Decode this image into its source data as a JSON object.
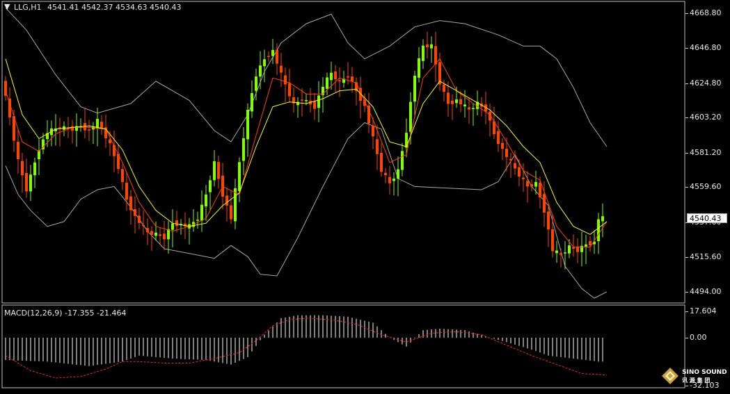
{
  "header": {
    "symbol": "LLG,H1",
    "ohlc": "4541.41 4542.37 4534.63 4540.43",
    "menu_icon": "triangle-down-icon"
  },
  "price_axis": {
    "ticks": [
      "4668.80",
      "4646.80",
      "4624.80",
      "4603.20",
      "4581.20",
      "4559.60",
      "4537.60",
      "4515.60",
      "4494.00"
    ],
    "tick_values": [
      4668.8,
      4646.8,
      4624.8,
      4603.2,
      4581.2,
      4559.6,
      4537.6,
      4515.6,
      4494.0
    ],
    "current_price": "4540.43"
  },
  "macd_panel": {
    "label": "MACD(12,26,9) -17.355 -21.464",
    "axis_ticks": [
      "17.604",
      "0.00",
      "-32.103"
    ],
    "tick_values": [
      17.604,
      0.0,
      -32.103
    ]
  },
  "logo": {
    "line1": "SINO SOUND",
    "line2": "讯 源 集 团"
  },
  "colors": {
    "background": "#000000",
    "bull": "#7fff00",
    "bear": "#ff4500",
    "bands": "#a9a9a9",
    "ma_fast": "#ff4500",
    "ma_slow": "#ffff00",
    "macd_hist": "#ffffff",
    "macd_signal": "#ff2020",
    "frame": "#c0c0c0"
  },
  "chart_data": {
    "type": "candlestick",
    "title": "LLG,H1",
    "ylim": [
      4487,
      4676
    ],
    "bar_spacing": 6,
    "anchors": [
      [
        0,
        4628
      ],
      [
        2,
        4603
      ],
      [
        4,
        4576
      ],
      [
        6,
        4558
      ],
      [
        9,
        4584
      ],
      [
        11,
        4594
      ],
      [
        14,
        4597
      ],
      [
        17,
        4596
      ],
      [
        19,
        4598
      ],
      [
        21,
        4595
      ],
      [
        23,
        4601
      ],
      [
        26,
        4586
      ],
      [
        28,
        4572
      ],
      [
        30,
        4552
      ],
      [
        32,
        4541
      ],
      [
        35,
        4531
      ],
      [
        37,
        4530
      ],
      [
        39,
        4528
      ],
      [
        41,
        4537
      ],
      [
        45,
        4535
      ],
      [
        47,
        4540
      ],
      [
        49,
        4555
      ],
      [
        51,
        4575
      ],
      [
        53,
        4555
      ],
      [
        55,
        4540
      ],
      [
        57,
        4575
      ],
      [
        59,
        4607
      ],
      [
        61,
        4630
      ],
      [
        63,
        4640
      ],
      [
        65,
        4645
      ],
      [
        67,
        4630
      ],
      [
        70,
        4611
      ],
      [
        72,
        4615
      ],
      [
        75,
        4610
      ],
      [
        77,
        4623
      ],
      [
        79,
        4631
      ],
      [
        81,
        4625
      ],
      [
        83,
        4630
      ],
      [
        85,
        4620
      ],
      [
        87,
        4610
      ],
      [
        89,
        4590
      ],
      [
        91,
        4570
      ],
      [
        93,
        4562
      ],
      [
        95,
        4570
      ],
      [
        97,
        4595
      ],
      [
        99,
        4630
      ],
      [
        101,
        4648
      ],
      [
        103,
        4648
      ],
      [
        105,
        4625
      ],
      [
        107,
        4612
      ],
      [
        109,
        4614
      ],
      [
        112,
        4608
      ],
      [
        114,
        4612
      ],
      [
        116,
        4608
      ],
      [
        118,
        4593
      ],
      [
        120,
        4583
      ],
      [
        122,
        4575
      ],
      [
        124,
        4567
      ],
      [
        126,
        4560
      ],
      [
        128,
        4562
      ],
      [
        130,
        4545
      ],
      [
        132,
        4520
      ],
      [
        134,
        4517
      ],
      [
        136,
        4522
      ],
      [
        138,
        4520
      ],
      [
        140,
        4524
      ],
      [
        142,
        4525
      ],
      [
        143,
        4540
      ]
    ],
    "upper_band": [
      [
        0,
        4672
      ],
      [
        5,
        4658
      ],
      [
        12,
        4630
      ],
      [
        18,
        4610
      ],
      [
        22,
        4606
      ],
      [
        30,
        4612
      ],
      [
        36,
        4626
      ],
      [
        44,
        4614
      ],
      [
        50,
        4595
      ],
      [
        54,
        4588
      ],
      [
        58,
        4605
      ],
      [
        62,
        4632
      ],
      [
        66,
        4650
      ],
      [
        72,
        4662
      ],
      [
        78,
        4668
      ],
      [
        82,
        4650
      ],
      [
        86,
        4640
      ],
      [
        92,
        4648
      ],
      [
        98,
        4660
      ],
      [
        104,
        4664
      ],
      [
        110,
        4662
      ],
      [
        118,
        4655
      ],
      [
        124,
        4648
      ],
      [
        128,
        4648
      ],
      [
        132,
        4640
      ],
      [
        136,
        4622
      ],
      [
        140,
        4600
      ],
      [
        144,
        4585
      ]
    ],
    "lower_band": [
      [
        0,
        4573
      ],
      [
        3,
        4555
      ],
      [
        6,
        4545
      ],
      [
        10,
        4535
      ],
      [
        14,
        4538
      ],
      [
        18,
        4552
      ],
      [
        22,
        4558
      ],
      [
        26,
        4560
      ],
      [
        30,
        4547
      ],
      [
        34,
        4532
      ],
      [
        38,
        4521
      ],
      [
        44,
        4518
      ],
      [
        50,
        4515
      ],
      [
        54,
        4523
      ],
      [
        58,
        4516
      ],
      [
        61,
        4505
      ],
      [
        65,
        4504
      ],
      [
        70,
        4528
      ],
      [
        76,
        4560
      ],
      [
        82,
        4590
      ],
      [
        86,
        4600
      ],
      [
        90,
        4596
      ],
      [
        94,
        4565
      ],
      [
        98,
        4560
      ],
      [
        106,
        4559
      ],
      [
        114,
        4558
      ],
      [
        118,
        4563
      ],
      [
        122,
        4580
      ],
      [
        126,
        4560
      ],
      [
        130,
        4548
      ],
      [
        134,
        4510
      ],
      [
        138,
        4496
      ],
      [
        141,
        4490
      ],
      [
        144,
        4494
      ]
    ],
    "ma_fast": [
      [
        0,
        4620
      ],
      [
        4,
        4588
      ],
      [
        8,
        4582
      ],
      [
        12,
        4593
      ],
      [
        16,
        4597
      ],
      [
        20,
        4597
      ],
      [
        24,
        4596
      ],
      [
        28,
        4575
      ],
      [
        32,
        4550
      ],
      [
        36,
        4535
      ],
      [
        40,
        4532
      ],
      [
        44,
        4535
      ],
      [
        48,
        4540
      ],
      [
        52,
        4560
      ],
      [
        56,
        4555
      ],
      [
        60,
        4592
      ],
      [
        64,
        4628
      ],
      [
        68,
        4625
      ],
      [
        72,
        4618
      ],
      [
        76,
        4618
      ],
      [
        80,
        4628
      ],
      [
        84,
        4625
      ],
      [
        88,
        4602
      ],
      [
        92,
        4575
      ],
      [
        96,
        4580
      ],
      [
        100,
        4628
      ],
      [
        104,
        4640
      ],
      [
        108,
        4620
      ],
      [
        112,
        4612
      ],
      [
        116,
        4605
      ],
      [
        120,
        4588
      ],
      [
        124,
        4570
      ],
      [
        128,
        4564
      ],
      [
        132,
        4535
      ],
      [
        136,
        4522
      ],
      [
        140,
        4522
      ],
      [
        144,
        4538
      ]
    ],
    "ma_slow": [
      [
        0,
        4640
      ],
      [
        4,
        4605
      ],
      [
        8,
        4590
      ],
      [
        12,
        4596
      ],
      [
        16,
        4597
      ],
      [
        20,
        4598
      ],
      [
        24,
        4596
      ],
      [
        28,
        4583
      ],
      [
        32,
        4560
      ],
      [
        36,
        4545
      ],
      [
        40,
        4537
      ],
      [
        44,
        4535
      ],
      [
        48,
        4537
      ],
      [
        52,
        4548
      ],
      [
        56,
        4556
      ],
      [
        60,
        4585
      ],
      [
        64,
        4610
      ],
      [
        68,
        4613
      ],
      [
        72,
        4612
      ],
      [
        76,
        4615
      ],
      [
        80,
        4620
      ],
      [
        84,
        4621
      ],
      [
        88,
        4610
      ],
      [
        92,
        4588
      ],
      [
        96,
        4585
      ],
      [
        100,
        4612
      ],
      [
        104,
        4626
      ],
      [
        108,
        4620
      ],
      [
        112,
        4614
      ],
      [
        116,
        4608
      ],
      [
        120,
        4598
      ],
      [
        124,
        4585
      ],
      [
        128,
        4575
      ],
      [
        132,
        4550
      ],
      [
        136,
        4535
      ],
      [
        140,
        4530
      ],
      [
        144,
        4538
      ]
    ],
    "macd_hist": [
      [
        0,
        -15
      ],
      [
        10,
        -16
      ],
      [
        20,
        -19
      ],
      [
        28,
        -16
      ],
      [
        32,
        -12
      ],
      [
        40,
        -14
      ],
      [
        48,
        -15
      ],
      [
        54,
        -18
      ],
      [
        58,
        -13
      ],
      [
        62,
        2
      ],
      [
        66,
        13
      ],
      [
        70,
        15
      ],
      [
        76,
        15
      ],
      [
        82,
        14
      ],
      [
        88,
        10
      ],
      [
        92,
        0
      ],
      [
        96,
        -6
      ],
      [
        100,
        5
      ],
      [
        104,
        6
      ],
      [
        110,
        5
      ],
      [
        116,
        0
      ],
      [
        120,
        -3
      ],
      [
        126,
        -8
      ],
      [
        130,
        -12
      ],
      [
        136,
        -14
      ],
      [
        142,
        -16
      ],
      [
        144,
        -16
      ]
    ],
    "macd_signal": [
      [
        0,
        -12
      ],
      [
        6,
        -22
      ],
      [
        12,
        -27
      ],
      [
        18,
        -26
      ],
      [
        24,
        -21
      ],
      [
        28,
        -16
      ],
      [
        32,
        -16
      ],
      [
        38,
        -17
      ],
      [
        44,
        -17
      ],
      [
        50,
        -14
      ],
      [
        56,
        -10
      ],
      [
        60,
        -2
      ],
      [
        64,
        8
      ],
      [
        68,
        12
      ],
      [
        72,
        13
      ],
      [
        78,
        12
      ],
      [
        84,
        9
      ],
      [
        90,
        2
      ],
      [
        96,
        -3
      ],
      [
        102,
        3
      ],
      [
        108,
        4
      ],
      [
        114,
        2
      ],
      [
        120,
        -5
      ],
      [
        126,
        -12
      ],
      [
        132,
        -18
      ],
      [
        138,
        -24
      ],
      [
        144,
        -25
      ]
    ]
  }
}
